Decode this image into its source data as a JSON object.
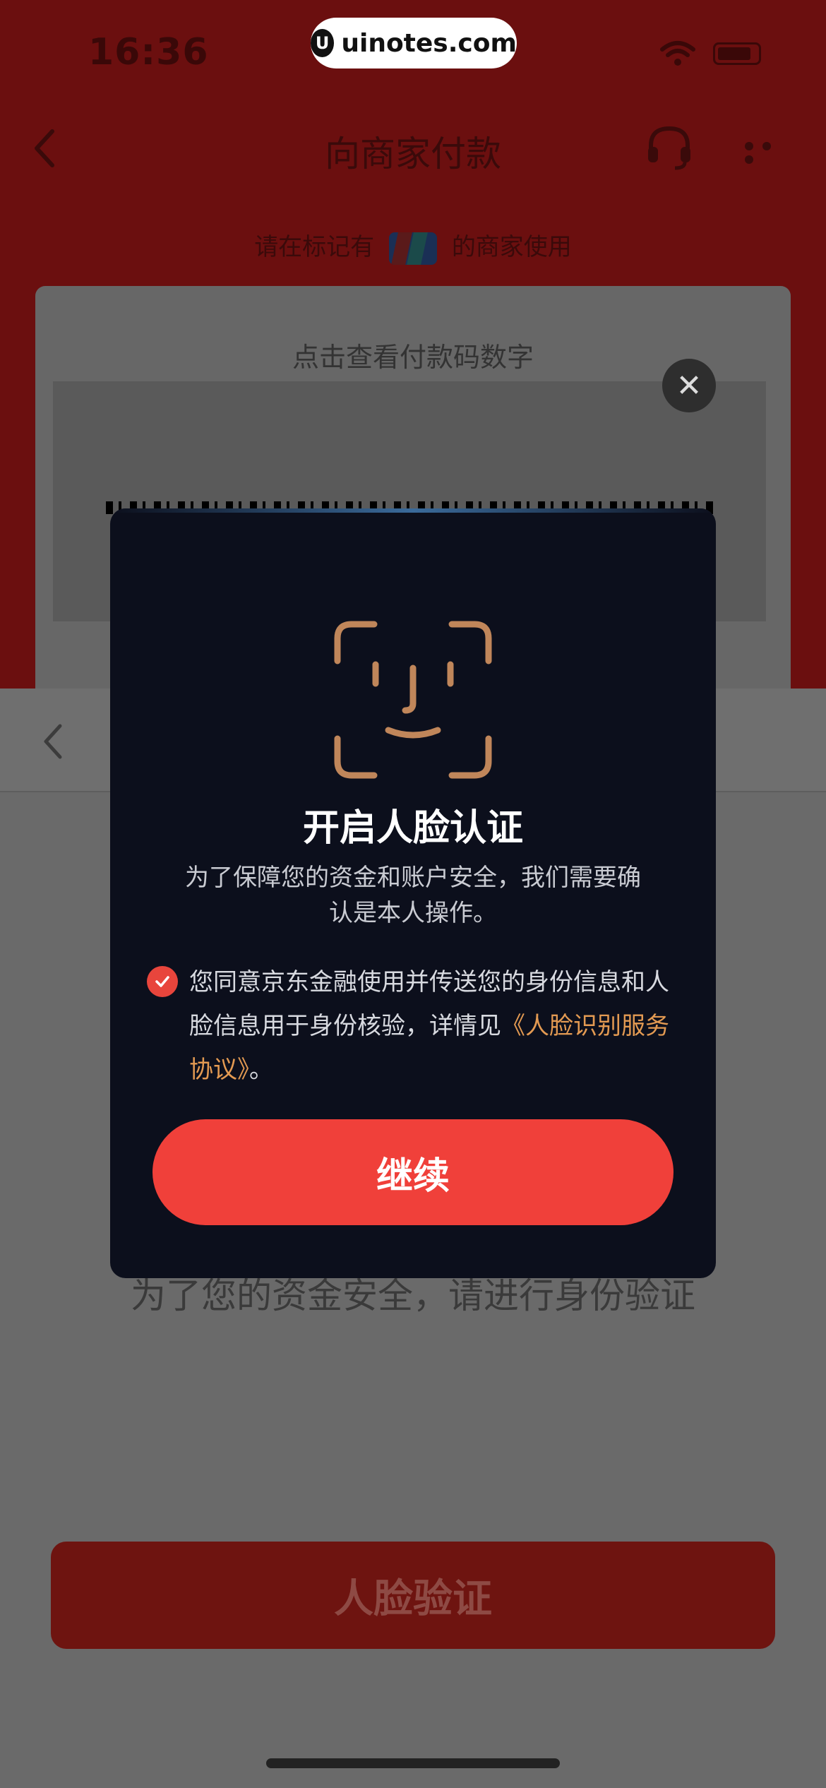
{
  "status_bar": {
    "time": "16:36"
  },
  "watermark": {
    "logo": "U",
    "text": "uinotes.com"
  },
  "nav": {
    "title": "向商家付款",
    "back_icon": "chevron-left-icon",
    "support_icon": "headset-icon",
    "more_icon": "more-dots-icon"
  },
  "hint": {
    "prefix": "请在标记有",
    "suffix": "的商家使用",
    "badge_icon": "unionpay-icon"
  },
  "pay_card": {
    "tap_hint": "点击查看付款码数字"
  },
  "verify_page": {
    "hint": "为了您的资金安全，请进行身份验证",
    "face_button": "人脸验证"
  },
  "modal": {
    "title": "开启人脸认证",
    "description": "为了保障您的资金和账户安全，我们需要确认是本人操作。",
    "agreement_text": "您同意京东金融使用并传送您的身份信息和人脸信息用于身份核验，详情见",
    "agreement_link": "《人脸识别服务协议》",
    "agreement_end": "。",
    "continue_label": "继续",
    "close_symbol": "✕"
  },
  "colors": {
    "accent": "#f0403a",
    "link": "#e39a52",
    "modal_bg": "#0c0f1c",
    "face_icon": "#c0865a"
  }
}
